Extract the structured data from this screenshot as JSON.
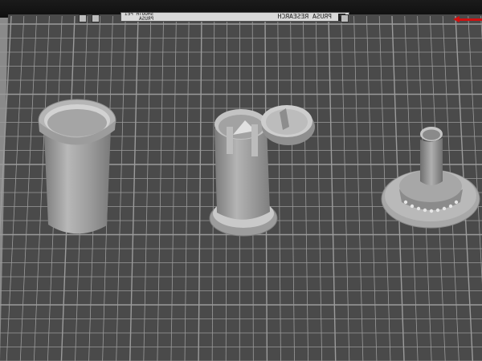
{
  "viewport": {
    "type": "3d-print-preview",
    "bed": {
      "sticker_text": "PRUSA RESEARCH",
      "sticker_subtext": [
        "SMOOTH PEI",
        "PRUSA"
      ],
      "grid": true,
      "colors": {
        "bed": "#4a4a4a",
        "grid": "#9a9a9a",
        "model": "#a6a6a6",
        "axis": "#d01010"
      }
    },
    "objects": [
      {
        "name": "cylinder-cup",
        "icon": "cylinder-cup-model"
      },
      {
        "name": "bottle-with-lid",
        "icon": "bottle-model"
      },
      {
        "name": "screw-lid",
        "icon": "lid-model"
      },
      {
        "name": "knob-with-base",
        "icon": "knob-model"
      }
    ]
  }
}
